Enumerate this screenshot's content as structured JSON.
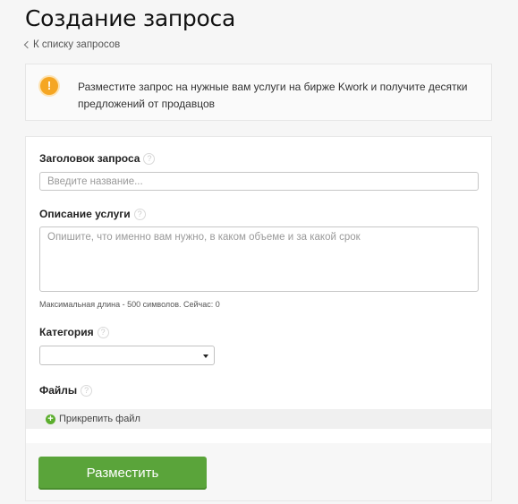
{
  "header": {
    "title": "Создание запроса",
    "back_link": "К списку запросов"
  },
  "notice": {
    "icon": "info-icon",
    "text": "Разместите запрос на нужные вам услуги на бирже Kwork и получите десятки предложений от продавцов"
  },
  "form": {
    "title_label": "Заголовок запроса",
    "title_placeholder": "Введите название...",
    "title_value": "",
    "description_label": "Описание услуги",
    "description_placeholder": "Опишите, что именно вам нужно, в каком объеме и за какой срок",
    "description_value": "",
    "length_hint": "Максимальная длина - 500 символов. Сейчас: 0",
    "category_label": "Категория",
    "category_value": "",
    "files_label": "Файлы",
    "attach_label": "Прикрепить файл",
    "submit_label": "Разместить",
    "help_glyph": "?"
  },
  "colors": {
    "accent_green": "#5aa43a",
    "info_orange": "#f5a623"
  }
}
